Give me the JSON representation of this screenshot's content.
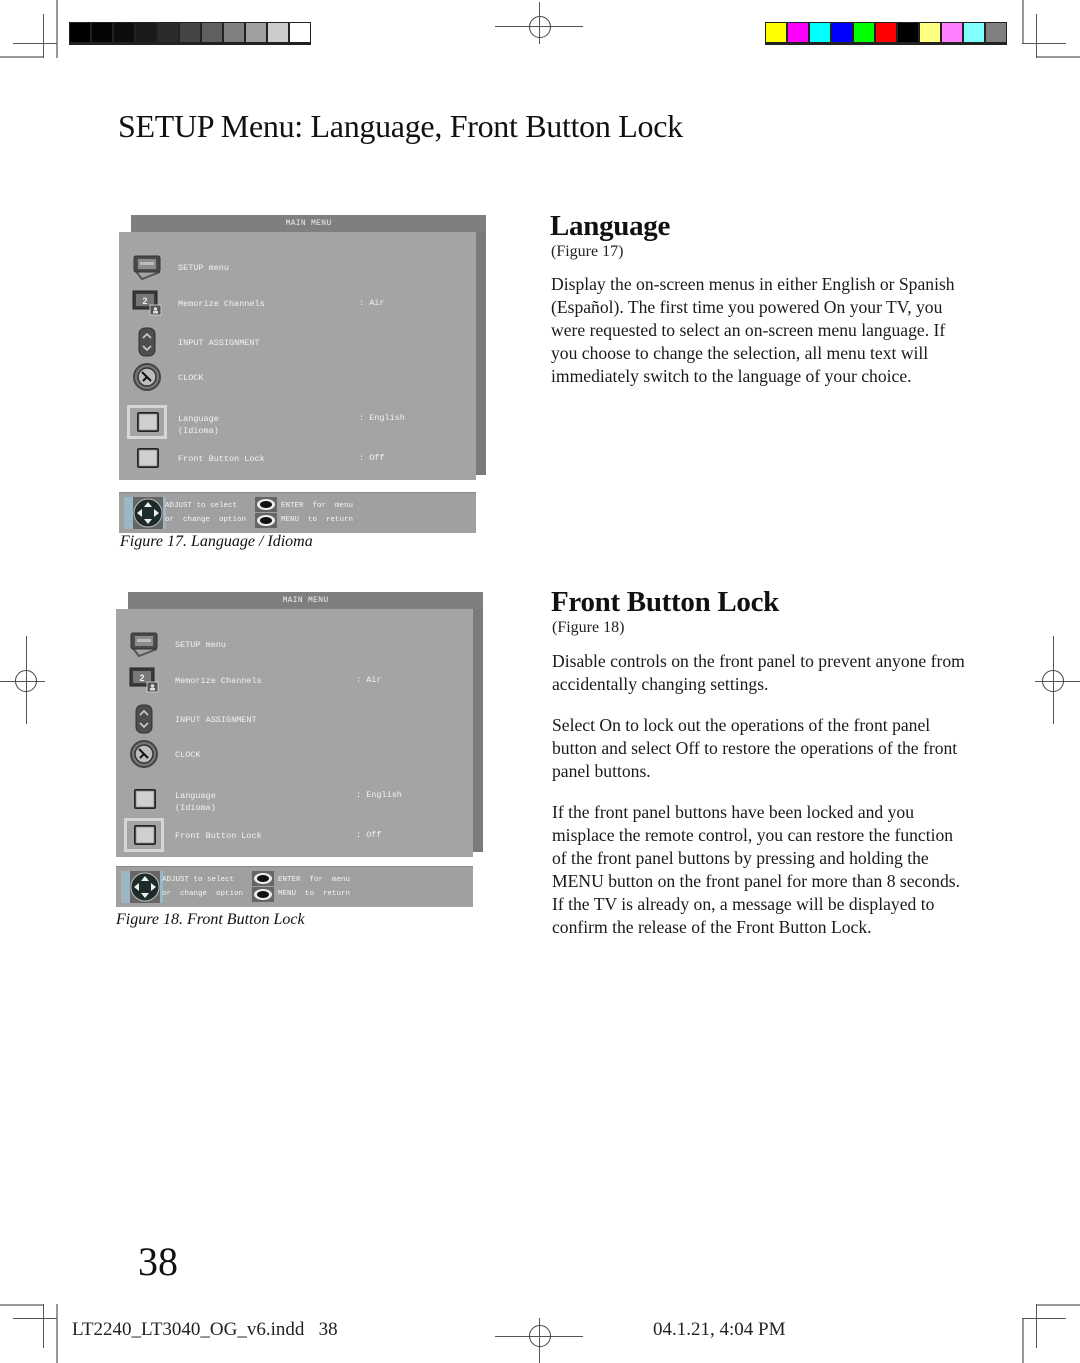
{
  "page": {
    "title": "SETUP Menu: Language, Front Button Lock",
    "page_number": "38",
    "footer": {
      "filename": "LT2240_LT3040_OG_v6.indd   38",
      "timestamp": "04.1.21, 4:04 PM"
    }
  },
  "color_bars": {
    "grayscale": [
      "#000000",
      "#050505",
      "#0d0d0d",
      "#1a1a1a",
      "#2b2b2b",
      "#444444",
      "#606060",
      "#808080",
      "#a0a0a0",
      "#cccccc",
      "#ffffff"
    ],
    "colors": [
      "#ffff00",
      "#ff00ff",
      "#00ffff",
      "#0000ff",
      "#00ff00",
      "#ff0000",
      "#000000",
      "#ffff80",
      "#ff80ff",
      "#80ffff",
      "#808080"
    ]
  },
  "figures": [
    {
      "menu_title": "MAIN MENU",
      "items": [
        {
          "icon": "tv-setup-icon",
          "label": "SETUP menu",
          "value": ""
        },
        {
          "icon": "memorize-channels-icon",
          "label": "Memorize Channels",
          "value": ": Air"
        },
        {
          "icon": "input-assignment-icon",
          "label": "INPUT ASSIGNMENT",
          "value": ""
        },
        {
          "icon": "clock-icon",
          "label": "CLOCK",
          "value": ""
        },
        {
          "icon": "square-button-icon",
          "label": "Language\n(Idioma)",
          "value": ": English"
        },
        {
          "icon": "square-button-icon",
          "label": "Front Button Lock",
          "value": ": Off"
        }
      ],
      "selected_index": 4,
      "help": {
        "adjust_line1": "ADJUST to select",
        "adjust_line2": "or  change  option",
        "enter_line": "ENTER  for  menu",
        "menu_line": "MENU  to  return"
      },
      "caption": "Figure 17. Language / Idioma"
    },
    {
      "menu_title": "MAIN MENU",
      "items": [
        {
          "icon": "tv-setup-icon",
          "label": "SETUP menu",
          "value": ""
        },
        {
          "icon": "memorize-channels-icon",
          "label": "Memorize Channels",
          "value": ": Air"
        },
        {
          "icon": "input-assignment-icon",
          "label": "INPUT ASSIGNMENT",
          "value": ""
        },
        {
          "icon": "clock-icon",
          "label": "CLOCK",
          "value": ""
        },
        {
          "icon": "square-button-icon",
          "label": "Language\n(Idioma)",
          "value": ": English"
        },
        {
          "icon": "square-button-icon",
          "label": "Front Button Lock",
          "value": ": Off"
        }
      ],
      "selected_index": 5,
      "help": {
        "adjust_line1": "ADJUST to select",
        "adjust_line2": "or  change  option",
        "enter_line": "ENTER  for  menu",
        "menu_line": "MENU  to  return"
      },
      "caption": "Figure 18. Front Button Lock"
    }
  ],
  "sections": {
    "language": {
      "title": "Language",
      "figure_ref": "(Figure 17)",
      "paragraphs": [
        "Display the on-screen menus in either English or Spanish (Español).  The first time you powered On your TV, you were requested to select an on-screen menu language.  If you choose to change the selection, all menu text will immediately switch to the language of your choice."
      ]
    },
    "front_button_lock": {
      "title": "Front Button Lock",
      "figure_ref": "(Figure 18)",
      "paragraphs": [
        "Disable controls on the front panel to prevent anyone from accidentally changing settings.",
        "Select On to lock out the operations of the front panel button and select Off to restore the operations of the front panel buttons.",
        "If the front panel buttons have been locked and you misplace the remote control, you can restore the function of the front panel buttons by pressing and holding the MENU button on the front panel  for more than 8 seconds.  If the TV is already on, a message will be displayed to confirm the release of the Front Button Lock."
      ]
    }
  }
}
